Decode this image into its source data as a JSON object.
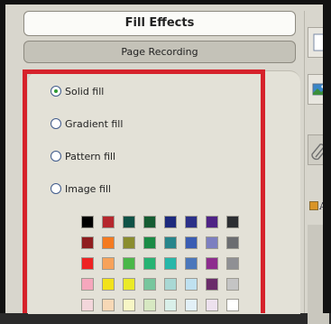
{
  "header": {
    "title": "Fill Effects",
    "subtitle": "Page Recording"
  },
  "fill_options": [
    {
      "label": "Solid fill",
      "selected": true
    },
    {
      "label": "Gradient fill",
      "selected": false
    },
    {
      "label": "Pattern fill",
      "selected": false
    },
    {
      "label": "Image fill",
      "selected": false
    }
  ],
  "swatches": [
    [
      "#000000",
      "#b5272d",
      "#0f5246",
      "#155c32",
      "#1d2a7d",
      "#2b3088",
      "#4e2385",
      "#2c2e31"
    ],
    [
      "#8f1d1f",
      "#f47a20",
      "#8a8d2e",
      "#1a8b45",
      "#27858b",
      "#3a5db3",
      "#7c7fc0",
      "#6b6d70"
    ],
    [
      "#ee2222",
      "#f7a25a",
      "#4ab749",
      "#27b373",
      "#27b7a9",
      "#4b77bb",
      "#8d2d8e",
      "#8f9094"
    ],
    [
      "#f6a7bd",
      "#f2e21b",
      "#eaea27",
      "#77c69d",
      "#a9d8d4",
      "#bfe1f0",
      "#6a2c6a",
      "#c4c4c4"
    ],
    [
      "#f3d6db",
      "#f7d8b6",
      "#f7f6c5",
      "#d7e8c2",
      "#d9efe9",
      "#e2f0f7",
      "#ede1ee",
      "#ffffff"
    ]
  ],
  "sidebar": {
    "partial_label": "A"
  },
  "colors": {
    "highlight": "#d6222b",
    "panel": "#e3e1d7",
    "frame": "#d8d6cd"
  }
}
